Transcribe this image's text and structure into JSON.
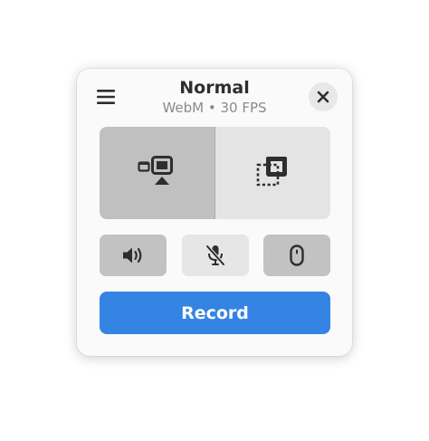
{
  "header": {
    "title": "Normal",
    "subtitle": "WebM • 30 FPS",
    "menu_icon": "hamburger-menu-icon",
    "close_icon": "close-icon"
  },
  "modes": [
    {
      "id": "screencast",
      "icon": "screen-cast-icon",
      "active": true
    },
    {
      "id": "selection",
      "icon": "area-selection-icon",
      "active": false
    }
  ],
  "toggles": [
    {
      "id": "desktop-audio",
      "icon": "speaker-icon",
      "enabled": true
    },
    {
      "id": "microphone",
      "icon": "microphone-muted-icon",
      "enabled": false
    },
    {
      "id": "pointer",
      "icon": "mouse-icon",
      "enabled": true
    }
  ],
  "record": {
    "label": "Record"
  },
  "colors": {
    "accent": "#3584e4",
    "active_fill": "#c0c0c0",
    "inactive_fill": "#e4e4e4"
  }
}
